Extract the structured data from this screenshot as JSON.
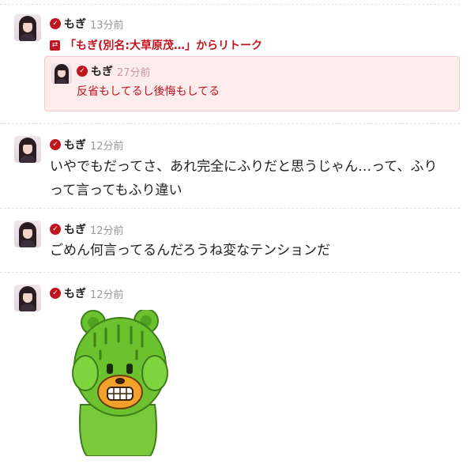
{
  "posts": [
    {
      "user": "もぎ",
      "time": "13分前",
      "retweet": "「もぎ(別名:大草原茂…」からリトーク",
      "quote": {
        "user": "もぎ",
        "time": "27分前",
        "text": "反省もしてるし後悔もしてる"
      }
    },
    {
      "user": "もぎ",
      "time": "12分前",
      "text_lines": [
        "いやでもだってさ、あれ完全にふりだと思うじゃん…って、ふり",
        "って言ってもふり違い"
      ]
    },
    {
      "user": "もぎ",
      "time": "12分前",
      "text": "ごめん何言ってるんだろうね変なテンションだ"
    },
    {
      "user": "もぎ",
      "time": "12分前",
      "sticker": "green-bear-crying-sticker"
    }
  ],
  "icons": {
    "verified": "check-badge-icon",
    "retalk": "retalk-icon"
  },
  "colors": {
    "accent": "#c0141e",
    "quote_bg": "#fdecec",
    "sticker_green": "#6cc22e"
  }
}
